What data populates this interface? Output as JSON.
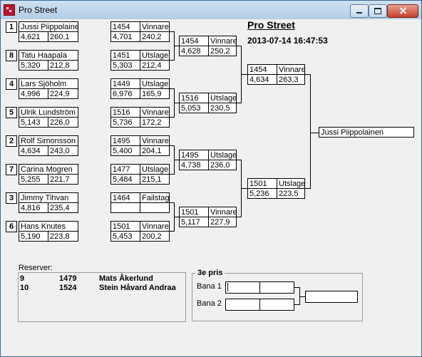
{
  "window": {
    "title": "Pro Street"
  },
  "header": {
    "title": "Pro Street",
    "timestamp": "2013-07-14 16:47:53"
  },
  "round1": [
    {
      "seed": "1",
      "name": "Jussi Piippolainen",
      "et": "4,621",
      "speed": "260,1",
      "car": "1454",
      "status": "Vinnare",
      "res_et": "4,701",
      "res_speed": "240,2"
    },
    {
      "seed": "8",
      "name": "Tatu Haapala",
      "et": "5,320",
      "speed": "212,8",
      "car": "1451",
      "status": "Utslagen",
      "res_et": "5,303",
      "res_speed": "212,4"
    },
    {
      "seed": "4",
      "name": "Lars Sjöholm",
      "et": "4,996",
      "speed": "224,9",
      "car": "1449",
      "status": "Utslagen",
      "res_et": "6,976",
      "res_speed": "165,9"
    },
    {
      "seed": "5",
      "name": "Ulrik Lundström",
      "et": "5,143",
      "speed": "226,0",
      "car": "1516",
      "status": "Vinnare",
      "res_et": "5,736",
      "res_speed": "172,2"
    },
    {
      "seed": "2",
      "name": "Rolf Simonsson",
      "et": "4,634",
      "speed": "243,0",
      "car": "1495",
      "status": "Vinnare",
      "res_et": "5,400",
      "res_speed": "204,1"
    },
    {
      "seed": "7",
      "name": "Carina Mogren",
      "et": "5,255",
      "speed": "221,7",
      "car": "1477",
      "status": "Utslagen",
      "res_et": "5,484",
      "res_speed": "215,1"
    },
    {
      "seed": "3",
      "name": "Jimmy Tihvan",
      "et": "4,816",
      "speed": "235,4",
      "car": "1464",
      "status": "Failstage",
      "res_et": "",
      "res_speed": ""
    },
    {
      "seed": "6",
      "name": "Hans Knutes",
      "et": "5,190",
      "speed": "223,8",
      "car": "1501",
      "status": "Vinnare",
      "res_et": "5,453",
      "res_speed": "200,2"
    }
  ],
  "quarter": [
    {
      "car": "1454",
      "status": "Vinnare",
      "et": "4,628",
      "speed": "250,2"
    },
    {
      "car": "1516",
      "status": "Utslagen",
      "et": "5,053",
      "speed": "230,5"
    },
    {
      "car": "1495",
      "status": "Utslagen",
      "et": "4,738",
      "speed": "236,0"
    },
    {
      "car": "1501",
      "status": "Vinnare",
      "et": "5,117",
      "speed": "227,9"
    }
  ],
  "semi": [
    {
      "car": "1454",
      "status": "Vinnare",
      "et": "4,634",
      "speed": "263,3"
    },
    {
      "car": "1501",
      "status": "Utslagen",
      "et": "5,236",
      "speed": "223,5"
    }
  ],
  "winner": "Jussi Piippolainen",
  "reserves": {
    "label": "Reserver:",
    "rows": [
      {
        "num": "9",
        "car": "1479",
        "name": "Mats Åkerlund"
      },
      {
        "num": "10",
        "car": "1524",
        "name": "Stein Håvard Andraa"
      }
    ]
  },
  "third_place": {
    "title": "3e pris",
    "lane1": "Bana 1",
    "lane2": "Bana 2"
  }
}
